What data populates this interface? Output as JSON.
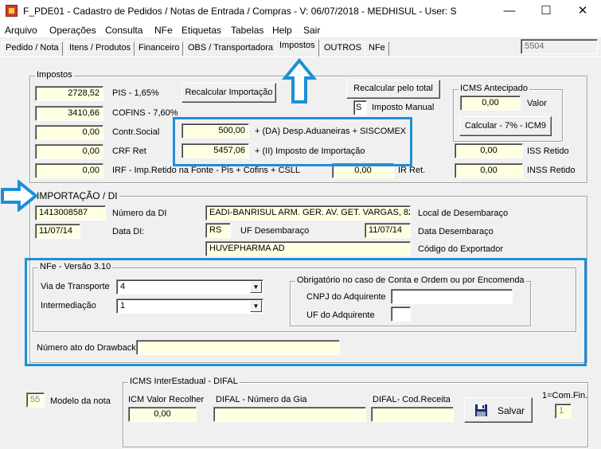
{
  "window": {
    "title": "F_PDE01 - Cadastro de Pedidos / Notas de Entrada / Compras - V: 06/07/2018 - MEDHISUL - User: S",
    "minimize": "—",
    "maximize": "☐",
    "close": "✕"
  },
  "menu": [
    "Arquivo",
    "Operações",
    "Consulta",
    "NFe",
    "Etiquetas",
    "Tabelas",
    "Help",
    "Sair"
  ],
  "tabs": [
    "Pedido / Nota",
    "Itens / Produtos",
    "Financeiro",
    "OBS / Transportadora",
    "Impostos",
    "OUTROS",
    "NFe"
  ],
  "tab_code": "5504",
  "impostos": {
    "legend": "Impostos",
    "pis_value": "2728,52",
    "pis_label": "PIS - 1,65%",
    "cofins_value": "3410,66",
    "cofins_label": "COFINS - 7,60%",
    "contr_value": "0,00",
    "contr_label": "Contr.Social",
    "crf_value": "0,00",
    "crf_label": "CRF  Ret",
    "irf_value": "0,00",
    "irf_label": "IRF - Imp.Retido na Fonte - Pis + Cofins + CSLL",
    "ir_value": "0,00",
    "ir_label": "IR  Ret.",
    "recalc_import_button": "Recalcular Importação",
    "recalc_total_button": "Recalcular pelo total",
    "imposto_manual_value": "S",
    "imposto_manual_label": "Imposto Manual",
    "da_value": "500,00",
    "da_label": "+ (DA) Desp.Aduaneiras + SISCOMEX",
    "ii_value": "5457,06",
    "ii_label": "+ (II) Imposto de Importação",
    "icms_antecipado_legend": "ICMS Antecipado",
    "icms_antecipado_value": "0,00",
    "valor_label": "Valor",
    "calc_button": "Calcular - 7% - ICM9",
    "iss_value": "0,00",
    "iss_label": "ISS Retido",
    "inss_value": "0,00",
    "inss_label": "INSS Retido"
  },
  "importacao": {
    "legend": "IMPORTAÇÃO  /  DI",
    "numero_di_value": "1413008587",
    "numero_di_label": "Número da DI",
    "data_di_value": "11/07/14",
    "data_di_label": "Data DI:",
    "local_value": "EADI-BANRISUL ARM. GER. AV. GET. VARGAS, 82",
    "local_label": "Local de Desembaraço",
    "uf_value": "RS",
    "uf_label": "UF Desembaraço",
    "data_desemb_value": "11/07/14",
    "data_desemb_label": "Data Desembaraço",
    "exportador_value": "HUVEPHARMA AD",
    "exportador_label": "Código do Exportador"
  },
  "nfe310": {
    "legend": "NFe - Versão 3.10",
    "via_label": "Via de Transporte",
    "via_value": "4",
    "intermediacao_label": "Intermediação",
    "intermediacao_value": "1",
    "obrigatorio_legend": "Obrigatório no caso de Conta e Ordem ou por Encomenda",
    "cnpj_label": "CNPJ do Adquirente",
    "cnpj_value": "",
    "uf_adq_label": "UF do Adquirente",
    "uf_adq_value": "",
    "drawback_label": "Número ato do Drawback",
    "drawback_value": ""
  },
  "modelo": {
    "value": "55",
    "label": "Modelo da nota"
  },
  "difal": {
    "legend": "ICMS InterEstadual - DIFAL",
    "icm_label": "ICM Valor Recolher",
    "icm_value": "0,00",
    "gia_label": "DIFAL - Número da Gia",
    "gia_value": "",
    "receita_label": "DIFAL- Cod.Receita",
    "receita_value": ""
  },
  "salvar_button": "Salvar",
  "comfin": {
    "label": "1=Com.Fin.",
    "value": "1"
  },
  "colors": {
    "highlight": "#1d8fd6",
    "field_yellow": "#ffffe1",
    "background": "#f0f0f0"
  },
  "icons": [
    "app-icon",
    "up-arrow-icon",
    "right-arrow-icon",
    "floppy-disk-icon",
    "chevron-down-icon"
  ]
}
